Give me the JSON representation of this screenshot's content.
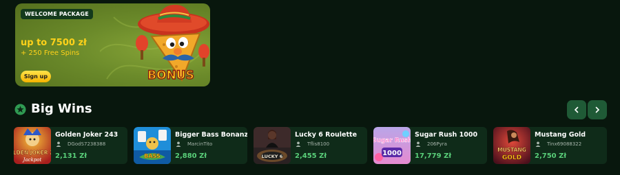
{
  "promo": {
    "badge": "WELCOME PACKAGE",
    "amount": "up to 7500 zł",
    "spins": "+ 250 Free Spins",
    "signup_label": "Sign up",
    "mascot_text": "BONUS"
  },
  "section": {
    "title": "Big Wins",
    "icon": "star-icon",
    "prev_icon": "chevron-left-icon",
    "next_icon": "chevron-right-icon"
  },
  "wins": [
    {
      "title": "Golden Joker 243",
      "user": "DGodS7238388",
      "amount": "2,131 Zł",
      "thumb_text": "GOLDEN JOKER 243",
      "thumb_sub": "Jackpot"
    },
    {
      "title": "Bigger Bass Bonanza",
      "user": "MarcinTito",
      "amount": "2,880 Zł",
      "thumb_text": "BASS",
      "thumb_sub": ""
    },
    {
      "title": "Lucky 6 Roulette",
      "user": "Tflis8100",
      "amount": "2,455 Zł",
      "thumb_text": "LUCKY 6",
      "thumb_sub": ""
    },
    {
      "title": "Sugar Rush 1000",
      "user": "206Pyra",
      "amount": "17,779 Zł",
      "thumb_text": "Sugar Rush",
      "thumb_sub": "1000"
    },
    {
      "title": "Mustang Gold",
      "user": "Tinx69088322",
      "amount": "2,750 Zł",
      "thumb_text": "MUSTANG",
      "thumb_sub": "GOLD"
    }
  ],
  "colors": {
    "background": "#08170d",
    "card": "#0f2b19",
    "amount": "#5ad07a",
    "promo_text": "#ffd21a",
    "nav_button": "#1f5a36"
  }
}
